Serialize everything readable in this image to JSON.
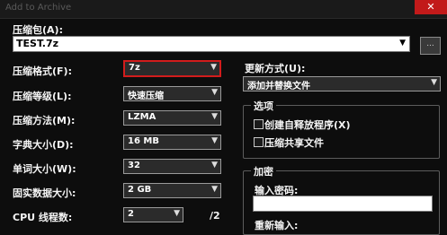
{
  "window": {
    "title": "Add to Archive",
    "close_glyph": "✕"
  },
  "archive": {
    "label": "压缩包(A):",
    "value": "TEST.7z",
    "browse_label": "..."
  },
  "left_fields": [
    {
      "label": "压缩格式(F):",
      "value": "7z"
    },
    {
      "label": "压缩等级(L):",
      "value": "快速压缩"
    },
    {
      "label": "压缩方法(M):",
      "value": "LZMA"
    },
    {
      "label": "字典大小(D):",
      "value": "16 MB"
    },
    {
      "label": "单词大小(W):",
      "value": "32"
    },
    {
      "label": "固实数据大小:",
      "value": "2 GB"
    },
    {
      "label": "CPU 线程数:",
      "value": "2",
      "suffix": "/2"
    }
  ],
  "update_mode": {
    "label": "更新方式(U):",
    "value": "添加并替换文件"
  },
  "options": {
    "title": "选项",
    "items": [
      {
        "label": "创建自释放程序(X)",
        "checked": false
      },
      {
        "label": "压缩共享文件",
        "checked": false
      }
    ]
  },
  "encryption": {
    "title": "加密",
    "password_label": "输入密码:",
    "reenter_label": "重新输入:"
  },
  "icons": {
    "dropdown": "chevron-down-icon",
    "close": "close-icon"
  },
  "colors": {
    "background": "#0d0d0d",
    "highlight_border": "#d21c1c",
    "close_button": "#c21a1a"
  }
}
